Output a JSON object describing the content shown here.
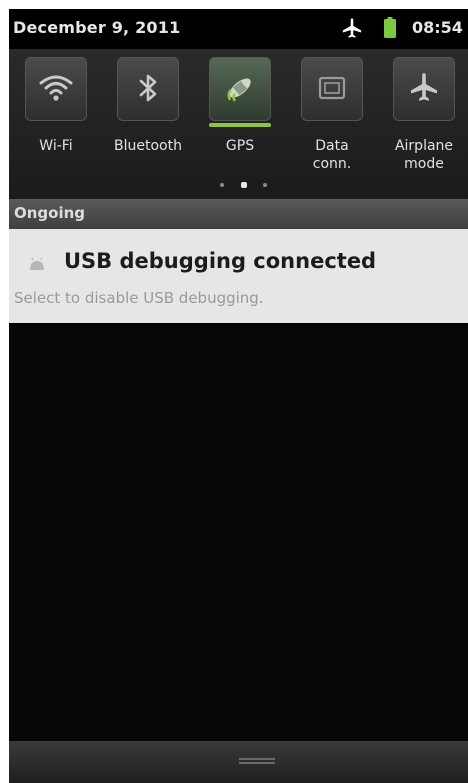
{
  "status_bar": {
    "date": "December 9, 2011",
    "time": "08:54",
    "icons": [
      "airplane-icon",
      "battery-icon"
    ],
    "battery_color": "#7ac943"
  },
  "quick_settings": {
    "tiles": [
      {
        "label": "Wi-Fi",
        "icon": "wifi-icon",
        "active": false
      },
      {
        "label": "Bluetooth",
        "icon": "bluetooth-icon",
        "active": false
      },
      {
        "label": "GPS",
        "icon": "gps-icon",
        "active": true
      },
      {
        "label": "Data\nconn.",
        "label_line1": "Data",
        "label_line2": "conn.",
        "icon": "data-connection-icon",
        "active": false
      },
      {
        "label": "Airplane\nmode",
        "label_line1": "Airplane",
        "label_line2": "mode",
        "icon": "airplane-mode-icon",
        "active": false
      }
    ],
    "page_count": 3,
    "current_page": 2,
    "active_indicator_color": "#8ec63f"
  },
  "ongoing": {
    "header": "Ongoing",
    "notification": {
      "title": "USB debugging connected",
      "subtitle": "Select to disable USB debugging.",
      "icon": "usb-icon"
    }
  },
  "bottom": {
    "handle_icon": "grip-handle-icon"
  }
}
